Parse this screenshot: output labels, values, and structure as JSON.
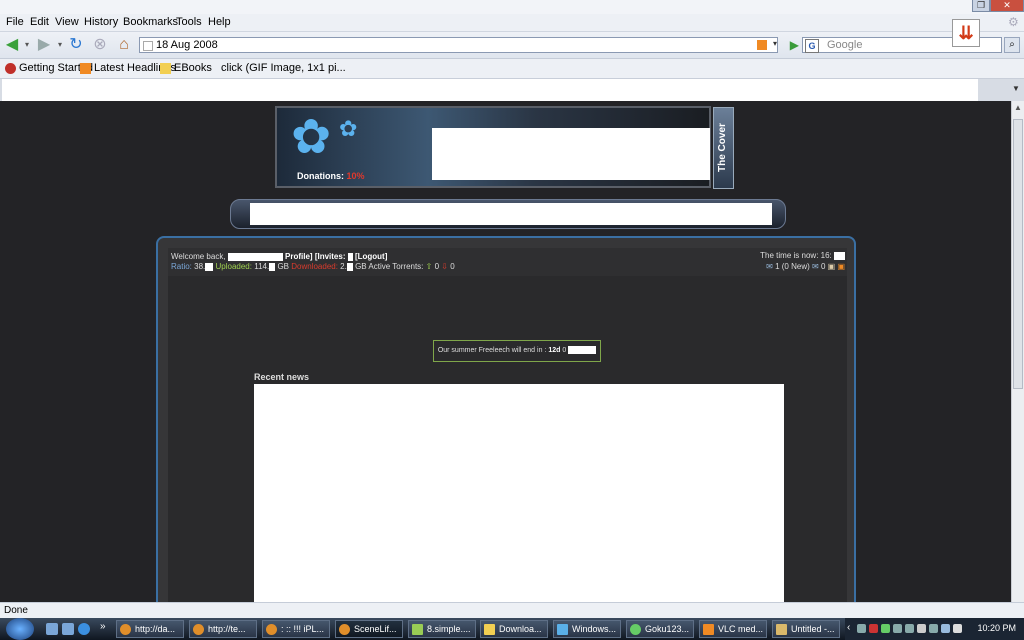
{
  "browser": {
    "menu": [
      "File",
      "Edit",
      "View",
      "History",
      "Bookmarks",
      "Tools",
      "Help"
    ],
    "url": "18 Aug 2008",
    "search_placeholder": "Google",
    "bookmarks": [
      "Getting Started",
      "Latest Headlines",
      "EBooks",
      "click (GIF Image, 1x1 pi..."
    ],
    "status": "Done"
  },
  "page": {
    "donations_label": "Donations:",
    "donations_value": "10%",
    "cover_tab": "The Cover",
    "welcome": "Welcome back,",
    "profile": "Profile]",
    "invites": "[Invites:",
    "logout": "[Logout]",
    "ratio_label": "Ratio:",
    "ratio_value": "38.",
    "uploaded_label": "Uploaded:",
    "uploaded_value": "114.",
    "uploaded_unit": "GB",
    "downloaded_label": "Downloaded:",
    "downloaded_value": "2.",
    "downloaded_unit": "GB",
    "active_torrents": "Active Torrents:",
    "seeding": "0",
    "leeching": "0",
    "time_label": "The time is now: 16:",
    "messages": "1 (0 New)",
    "messages_count": "0",
    "freeleech_prefix": "Our summer Freeleech will end in :",
    "freeleech_value": "12d",
    "freeleech_value_suffix": "0",
    "recent_news": "Recent news"
  },
  "taskbar": {
    "items": [
      "http://da...",
      "http://te...",
      ": :: !!! iPL...",
      "SceneLif...",
      "8.simple....",
      "Downloa...",
      "Windows...",
      "Goku123...",
      "VLC med...",
      "Untitled -..."
    ],
    "clock": "10:20 PM"
  },
  "colors": {
    "page_bg": "#232326",
    "panel_border": "#3a6fa3",
    "uploaded": "#9fd14f",
    "downloaded": "#d93b2d"
  }
}
